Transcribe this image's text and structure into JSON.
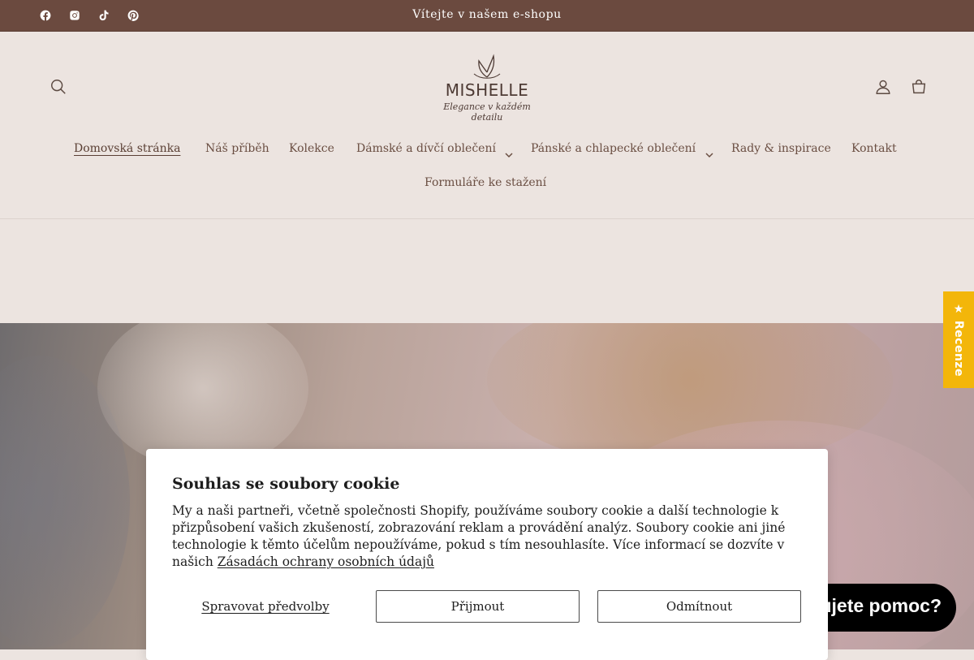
{
  "announcement": "Vítejte v našem e-shopu",
  "social": [
    "facebook-icon",
    "instagram-icon",
    "tiktok-icon",
    "pinterest-icon"
  ],
  "brand": {
    "name": "MISHELLE",
    "tagline": "Elegance v každém detailu"
  },
  "nav": {
    "items": [
      {
        "label": "Domovská stránka",
        "active": true
      },
      {
        "label": "Náš příběh"
      },
      {
        "label": "Kolekce"
      },
      {
        "label": "Dámské a dívčí oblečení",
        "dropdown": true
      },
      {
        "label": "Pánské a chlapecké oblečení",
        "dropdown": true
      },
      {
        "label": "Rady & inspirace"
      },
      {
        "label": "Kontakt"
      },
      {
        "label": "Formuláře ke stažení"
      }
    ]
  },
  "cookie": {
    "title": "Souhlas se soubory cookie",
    "text": "My a naši partneři, včetně společnosti Shopify, používáme soubory cookie a další technologie k přizpůsobení vašich zkušeností, zobrazování reklam a provádění analýz. Soubory cookie ani jiné technologie k těmto účelům nepoužíváme, pokud s tím nesouhlasíte. Více informací se dozvíte v našich ",
    "link": "Zásadách ochrany osobních údajů",
    "manage": "Spravovat předvolby",
    "accept": "Přijmout",
    "decline": "Odmítnout"
  },
  "help": "Potřebujete pomoc?",
  "review_tab": "★ Recenze",
  "colors": {
    "topbar": "#6b4a3f",
    "page_bg": "#ece4e0",
    "review_tab": "#f3b60a",
    "help_bubble": "#000000"
  }
}
